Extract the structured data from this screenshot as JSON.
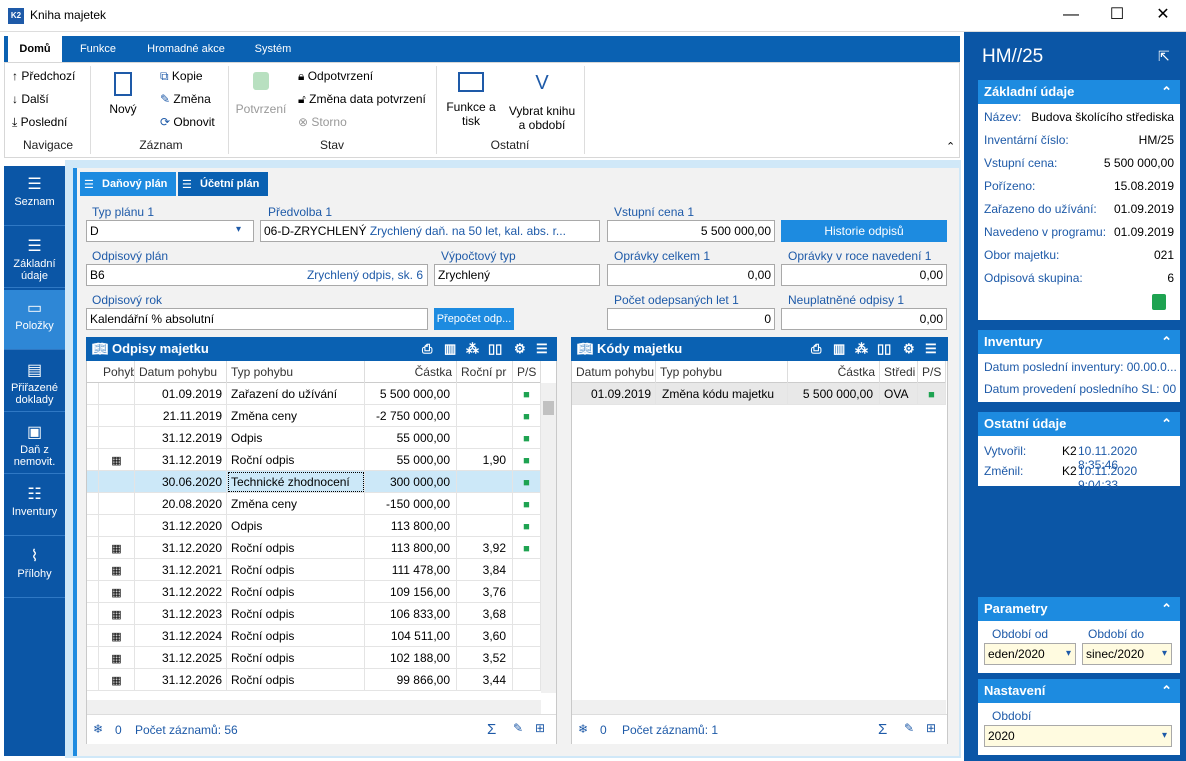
{
  "window": {
    "title": "Kniha majetek",
    "app_badge": "K2"
  },
  "ribbon": {
    "tabs": [
      "Domů",
      "Funkce",
      "Hromadné akce",
      "Systém"
    ],
    "nav": {
      "prev": "Předchozí",
      "next": "Další",
      "last": "Poslední",
      "group": "Navigace"
    },
    "record": {
      "new": "Nový",
      "copy": "Kopie",
      "edit": "Změna",
      "refresh": "Obnovit",
      "group": "Záznam"
    },
    "state": {
      "confirm": "Potvrzení",
      "unconfirm": "Odpotvrzení",
      "change_date": "Změna data potvrzení",
      "storno": "Storno",
      "group": "Stav"
    },
    "other": {
      "print": "Funkce a tisk",
      "select": "Vybrat knihu a období",
      "group": "Ostatní"
    }
  },
  "nav": {
    "items": [
      {
        "label": "Seznam",
        "icon": "list-icon"
      },
      {
        "label": "Základní údaje",
        "icon": "list-icon"
      },
      {
        "label": "Položky",
        "icon": "box-icon"
      },
      {
        "label": "Přiřazené doklady",
        "icon": "document-icon"
      },
      {
        "label": "Daň z nemovit.",
        "icon": "tax-icon"
      },
      {
        "label": "Inventury",
        "icon": "checklist-icon"
      },
      {
        "label": "Přílohy",
        "icon": "paperclip-icon"
      }
    ]
  },
  "tabs": {
    "tax_plan": "Daňový plán",
    "acc_plan": "Účetní plán"
  },
  "form": {
    "plan_type": {
      "label": "Typ plánu 1",
      "value": "D"
    },
    "preset": {
      "label": "Předvolba 1",
      "code": "06-D-ZRYCHLENÝ",
      "desc": "Zrychlený daň. na 50 let, kal. abs. r..."
    },
    "input_price": {
      "label": "Vstupní cena 1",
      "value": "5 500 000,00"
    },
    "history_btn": "Historie odpisů",
    "depr_plan": {
      "label": "Odpisový plán",
      "code": "B6",
      "desc": "Zrychlený odpis, sk. 6"
    },
    "calc_type": {
      "label": "Výpočtový typ",
      "value": "Zrychlený"
    },
    "total_adj": {
      "label": "Oprávky celkem 1",
      "value": "0,00"
    },
    "adj_year": {
      "label": "Oprávky v roce navedení 1",
      "value": "0,00"
    },
    "depr_year": {
      "label": "Odpisový rok",
      "value": "Kalendářní % absolutní"
    },
    "recalc_btn": "Přepočet odp...",
    "years_count": {
      "label": "Počet odepsaných let 1",
      "value": "0"
    },
    "unused": {
      "label": "Neuplatněné odpisy 1",
      "value": "0,00"
    }
  },
  "left_grid": {
    "title": "Odpisy majetku",
    "columns": [
      "Pohyb",
      "Datum pohybu",
      "Typ pohybu",
      "Částka",
      "Roční pr",
      "P/S"
    ],
    "rows": [
      {
        "cal": false,
        "date": "01.09.2019",
        "type": "Zařazení do užívání",
        "amount": "5 500 000,00",
        "rate": "",
        "lock": true
      },
      {
        "cal": false,
        "date": "21.11.2019",
        "type": "Změna ceny",
        "amount": "-2 750 000,00",
        "rate": "",
        "lock": true
      },
      {
        "cal": false,
        "date": "31.12.2019",
        "type": "Odpis",
        "amount": "55 000,00",
        "rate": "",
        "lock": true
      },
      {
        "cal": true,
        "date": "31.12.2019",
        "type": "Roční odpis",
        "amount": "55 000,00",
        "rate": "1,90",
        "lock": true
      },
      {
        "cal": false,
        "date": "30.06.2020",
        "type": "Technické zhodnocení",
        "amount": "300 000,00",
        "rate": "",
        "lock": true
      },
      {
        "cal": false,
        "date": "20.08.2020",
        "type": "Změna ceny",
        "amount": "-150 000,00",
        "rate": "",
        "lock": true
      },
      {
        "cal": false,
        "date": "31.12.2020",
        "type": "Odpis",
        "amount": "113 800,00",
        "rate": "",
        "lock": true
      },
      {
        "cal": true,
        "date": "31.12.2020",
        "type": "Roční odpis",
        "amount": "113 800,00",
        "rate": "3,92",
        "lock": true
      },
      {
        "cal": true,
        "date": "31.12.2021",
        "type": "Roční odpis",
        "amount": "111 478,00",
        "rate": "3,84",
        "lock": false
      },
      {
        "cal": true,
        "date": "31.12.2022",
        "type": "Roční odpis",
        "amount": "109 156,00",
        "rate": "3,76",
        "lock": false
      },
      {
        "cal": true,
        "date": "31.12.2023",
        "type": "Roční odpis",
        "amount": "106 833,00",
        "rate": "3,68",
        "lock": false
      },
      {
        "cal": true,
        "date": "31.12.2024",
        "type": "Roční odpis",
        "amount": "104 511,00",
        "rate": "3,60",
        "lock": false
      },
      {
        "cal": true,
        "date": "31.12.2025",
        "type": "Roční odpis",
        "amount": "102 188,00",
        "rate": "3,52",
        "lock": false
      },
      {
        "cal": true,
        "date": "31.12.2026",
        "type": "Roční odpis",
        "amount": "99 866,00",
        "rate": "3,44",
        "lock": false
      }
    ],
    "footer": {
      "zero": "0",
      "count": "Počet záznamů: 56"
    }
  },
  "right_grid": {
    "title": "Kódy majetku",
    "columns": [
      "Datum pohybu",
      "Typ pohybu",
      "Částka",
      "Středi",
      "P/S"
    ],
    "rows": [
      {
        "date": "01.09.2019",
        "type": "Změna kódu majetku",
        "amount": "5 500 000,00",
        "center": "OVA",
        "lock": true
      }
    ],
    "footer": {
      "zero": "0",
      "count": "Počet záznamů: 1"
    }
  },
  "side": {
    "title": "HM//25",
    "basic": {
      "header": "Základní údaje",
      "rows": [
        {
          "k": "Název:",
          "v": "Budova školícího střediska"
        },
        {
          "k": "Inventární číslo:",
          "v": "HM/25"
        },
        {
          "k": "Vstupní cena:",
          "v": "5 500 000,00"
        },
        {
          "k": "Pořízeno:",
          "v": "15.08.2019"
        },
        {
          "k": "Zařazeno do užívání:",
          "v": "01.09.2019"
        },
        {
          "k": "Navedeno v programu:",
          "v": "01.09.2019"
        },
        {
          "k": "Obor majetku:",
          "v": "021"
        },
        {
          "k": "Odpisová skupina:",
          "v": "6"
        }
      ]
    },
    "inventory": {
      "header": "Inventury",
      "last": "Datum poslední inventury: 00.00.0...",
      "last_sl": "Datum provedení posledního SL: 00..."
    },
    "other": {
      "header": "Ostatní údaje",
      "created_k": "Vytvořil:",
      "created_user": "K2",
      "created_v": "10.11.2020 8:35:46",
      "changed_k": "Změnil:",
      "changed_user": "K2",
      "changed_v": "10.11.2020 9:04:33"
    },
    "params": {
      "header": "Parametry",
      "from_label": "Období od",
      "from_value": "eden/2020",
      "to_label": "Období do",
      "to_value": "sinec/2020"
    },
    "settings": {
      "header": "Nastavení",
      "period_label": "Období",
      "period_value": "2020"
    }
  }
}
